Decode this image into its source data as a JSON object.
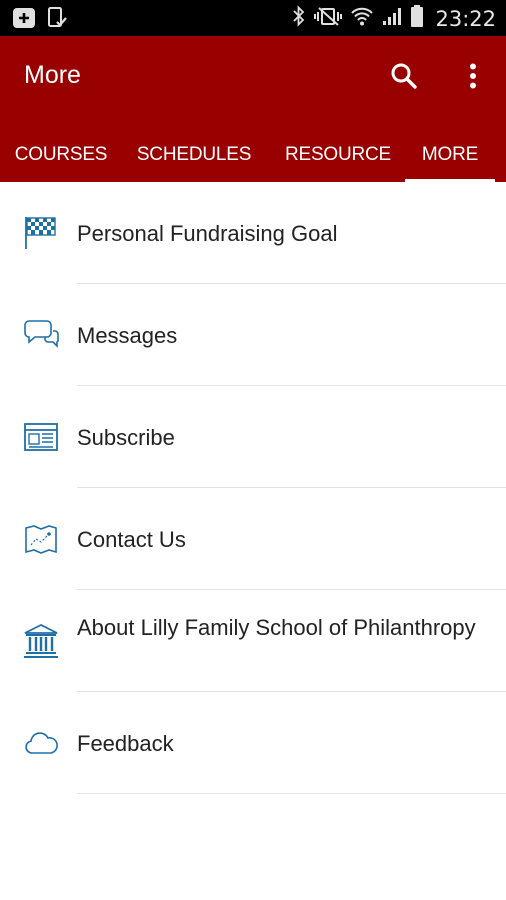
{
  "status_bar": {
    "time": "23:22",
    "icons": [
      "add-box-icon",
      "device-check-icon",
      "bluetooth-icon",
      "vibrate-mute-icon",
      "wifi-icon",
      "signal-icon",
      "battery-icon"
    ]
  },
  "app_bar": {
    "title": "More",
    "background": "#990000",
    "actions": [
      "search-icon",
      "overflow-menu-icon"
    ]
  },
  "tabs": [
    {
      "label": "COURSES",
      "active": false
    },
    {
      "label": "SCHEDULES",
      "active": false
    },
    {
      "label": "RESOURCE",
      "active": false
    },
    {
      "label": "MORE",
      "active": true
    }
  ],
  "menu": {
    "icon_color": "#1e6fa8",
    "items": [
      {
        "label": "Personal Fundraising Goal",
        "icon": "checkered-flag-icon"
      },
      {
        "label": "Messages",
        "icon": "chat-bubbles-icon"
      },
      {
        "label": "Subscribe",
        "icon": "newsletter-icon"
      },
      {
        "label": "Contact Us",
        "icon": "map-icon"
      },
      {
        "label": "About Lilly Family School of Philanthropy",
        "icon": "institution-icon"
      },
      {
        "label": "Feedback",
        "icon": "cloud-icon"
      }
    ]
  }
}
